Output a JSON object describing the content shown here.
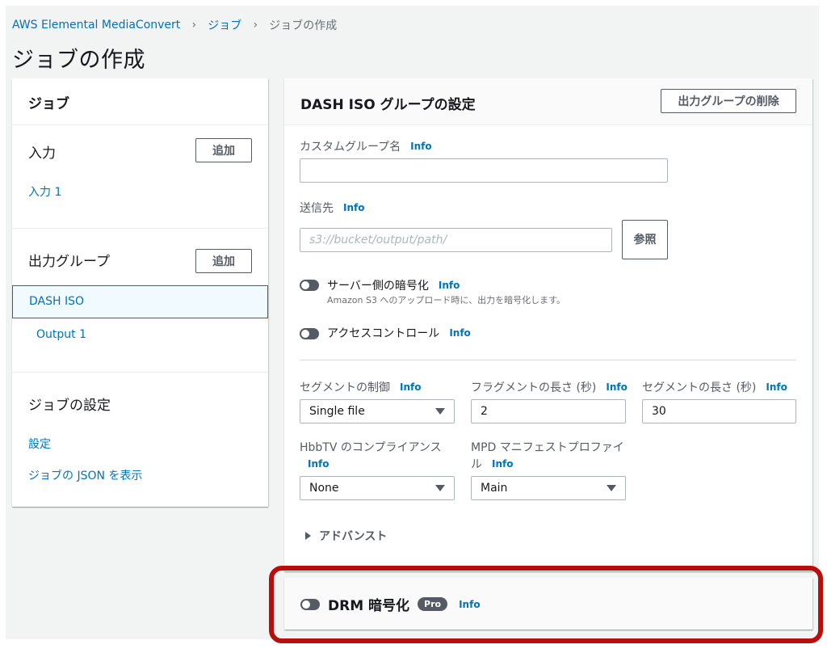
{
  "breadcrumb": {
    "items": [
      "AWS Elemental MediaConvert",
      "ジョブ",
      "ジョブの作成"
    ],
    "separator": "›"
  },
  "page_title": "ジョブの作成",
  "nav": {
    "header": "ジョブ",
    "inputs": {
      "title": "入力",
      "add_label": "追加",
      "items": [
        "入力 1"
      ]
    },
    "output_groups": {
      "title": "出力グループ",
      "add_label": "追加",
      "selected": "DASH ISO",
      "outputs": [
        "Output 1"
      ]
    },
    "job_settings": {
      "title": "ジョブの設定",
      "links": [
        "設定",
        "ジョブの JSON を表示"
      ]
    }
  },
  "panel": {
    "title": "DASH ISO グループの設定",
    "delete_label": "出力グループの削除",
    "info_label": "Info",
    "custom_group_name": {
      "label": "カスタムグループ名",
      "value": ""
    },
    "destination": {
      "label": "送信先",
      "placeholder": "s3://bucket/output/path/",
      "browse_label_1": "参",
      "browse_label_2": "照"
    },
    "server_side_encryption": {
      "label": "サーバー側の暗号化",
      "description": "Amazon S3 へのアップロード時に、出力を暗号化します。",
      "enabled": false
    },
    "access_control": {
      "label": "アクセスコントロール",
      "enabled": false
    },
    "segment_control": {
      "label": "セグメントの制御",
      "value": "Single file"
    },
    "fragment_length": {
      "label": "フラグメントの長さ (秒)",
      "value": "2"
    },
    "segment_length": {
      "label": "セグメントの長さ (秒)",
      "value": "30"
    },
    "hbbtv": {
      "label": "HbbTV のコンプライアンス",
      "value": "None"
    },
    "mpd_profile": {
      "label_1": "MPD マニフェストプロファイ",
      "label_2": "ル",
      "value": "Main"
    },
    "advanced_label": "アドバンスト"
  },
  "drm": {
    "label": "DRM 暗号化",
    "badge": "Pro",
    "info_label": "Info",
    "enabled": false
  },
  "colors": {
    "link": "#0073bb",
    "highlight": "#b80e0e",
    "toggle_off": "#545b64"
  }
}
